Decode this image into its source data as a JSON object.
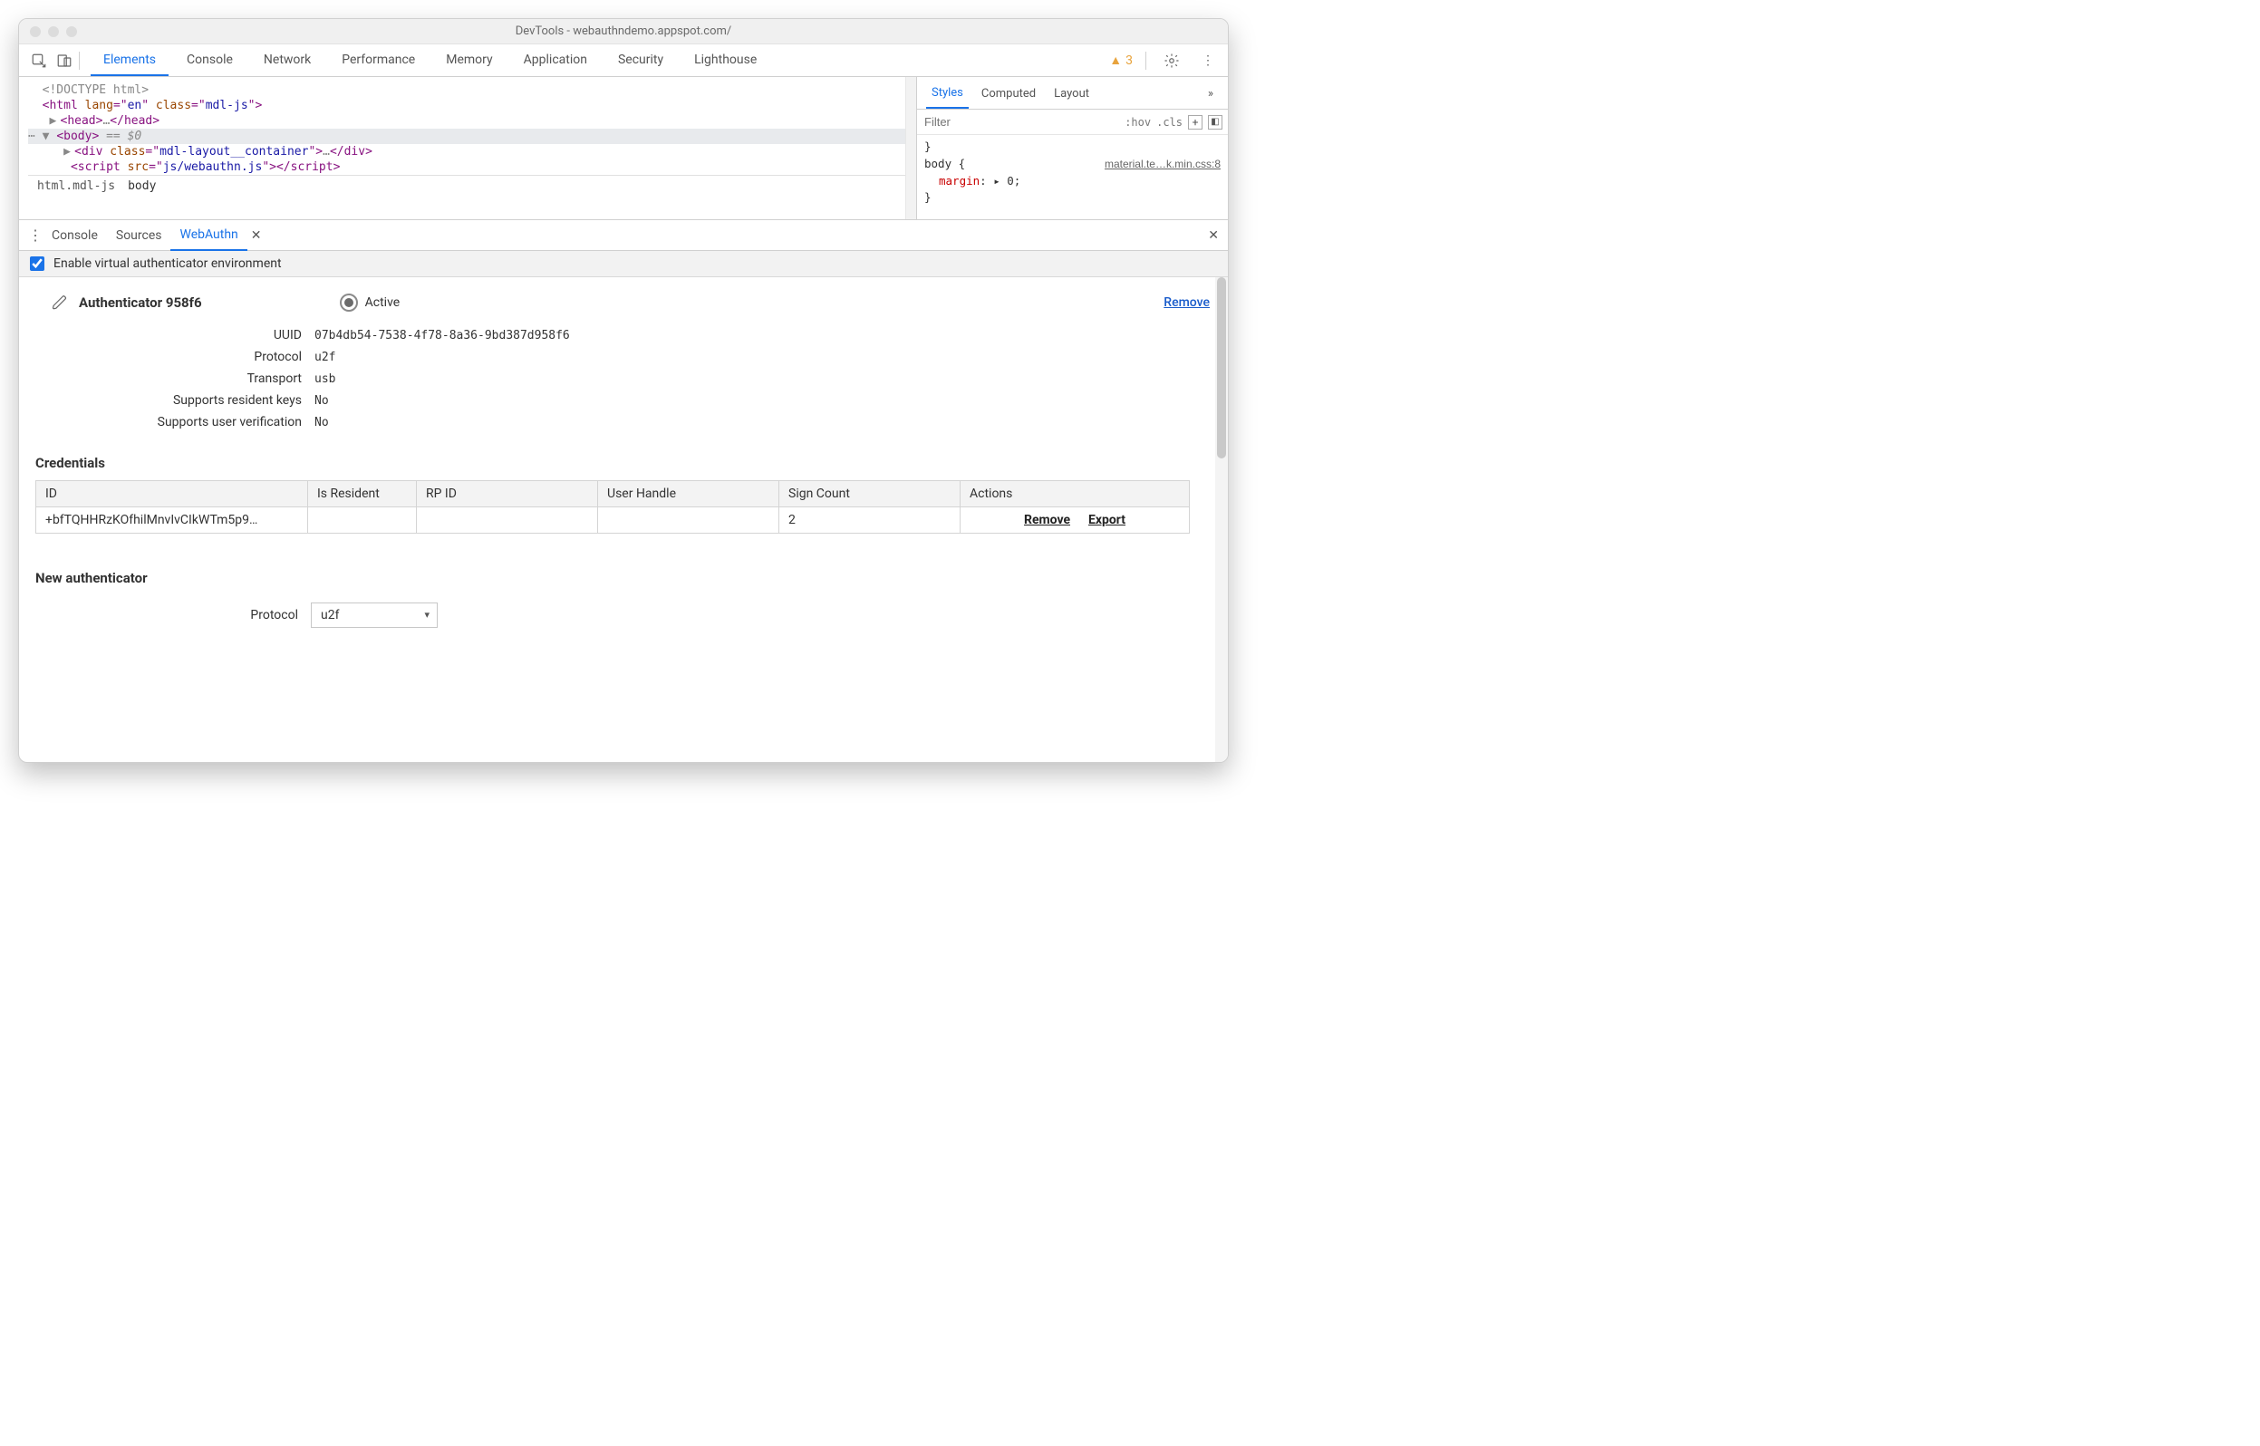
{
  "window": {
    "title": "DevTools - webauthndemo.appspot.com/"
  },
  "mainTabs": [
    "Elements",
    "Console",
    "Network",
    "Performance",
    "Memory",
    "Application",
    "Security",
    "Lighthouse"
  ],
  "mainActive": "Elements",
  "warnCount": "3",
  "dom": {
    "l1": "<!DOCTYPE html>",
    "l2_open": "<",
    "l2_tag": "html",
    "l2_a1n": " lang",
    "l2_eq": "=\"",
    "l2_a1v": "en",
    "l2_q": "\"",
    "l2_a2n": " class",
    "l2_a2v": "mdl-js",
    "l2_close": ">",
    "l3_open": "<",
    "l3_tag": "head",
    "l3_close": ">",
    "l3_ell": "…",
    "l3_end": "</",
    "l3_endtag": "head",
    "l3_endc": ">",
    "l4_open": "<",
    "l4_tag": "body",
    "l4_close": ">",
    "l4_eq": " == ",
    "l4_dollar": "$0",
    "l5_open": "<",
    "l5_tag": "div",
    "l5_an": " class",
    "l5_eq": "=\"",
    "l5_av": "mdl-layout__container",
    "l5_q": "\"",
    "l5_close": ">",
    "l5_ell": "…",
    "l5_end": "</",
    "l5_endtag": "div",
    "l5_endc": ">",
    "l6_open": "<",
    "l6_tag": "script",
    "l6_an": " src",
    "l6_eq": "=\"",
    "l6_av": "js/webauthn.js",
    "l6_q": "\"",
    "l6_close": ">",
    "l6_end": "</",
    "l6_endtag": "script",
    "l6_endc": ">"
  },
  "crumbs": {
    "c1": "html.mdl-js",
    "c2": "body"
  },
  "stylesTabs": [
    "Styles",
    "Computed",
    "Layout"
  ],
  "stylesActive": "Styles",
  "stylesFilterPlaceholder": "Filter",
  "hov": ":hov",
  "cls": ".cls",
  "stylesRule": {
    "openBrace": "}",
    "selector": "body {",
    "link": "material.te…k.min.css:8",
    "prop": "margin",
    "colon": ": ▸ ",
    "val": "0;",
    "closeBrace": "}"
  },
  "drawerTabs": [
    "Console",
    "Sources",
    "WebAuthn"
  ],
  "drawerActive": "WebAuthn",
  "enableLabel": "Enable virtual authenticator environment",
  "auth": {
    "title": "Authenticator 958f6",
    "active": "Active",
    "remove": "Remove",
    "rows": [
      {
        "label": "UUID",
        "val": "07b4db54-7538-4f78-8a36-9bd387d958f6"
      },
      {
        "label": "Protocol",
        "val": "u2f"
      },
      {
        "label": "Transport",
        "val": "usb"
      },
      {
        "label": "Supports resident keys",
        "val": "No"
      },
      {
        "label": "Supports user verification",
        "val": "No"
      }
    ]
  },
  "credsHeading": "Credentials",
  "credsCols": [
    "ID",
    "Is Resident",
    "RP ID",
    "User Handle",
    "Sign Count",
    "Actions"
  ],
  "credsRow": {
    "id": "+bfTQHHRzKOfhilMnvIvCIkWTm5p9…",
    "isResident": "",
    "rpId": "",
    "userHandle": "",
    "signCount": "2",
    "actionRemove": "Remove",
    "actionExport": "Export"
  },
  "newAuth": {
    "heading": "New authenticator",
    "protocolLabel": "Protocol",
    "protocolValue": "u2f"
  }
}
